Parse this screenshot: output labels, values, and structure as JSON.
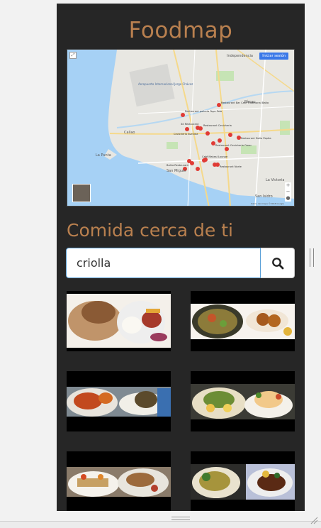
{
  "app": {
    "title": "Foodmap"
  },
  "map": {
    "button_label": "Iniciar sesión",
    "labels": {
      "independencia": "Independencia",
      "callao": "Callao",
      "rimac": "Rímac",
      "surquillo": "San Miguel",
      "la_victoria": "La Victoria",
      "san_isidro": "San Isidro",
      "la_punta": "La Punta",
      "aeropuerto": "Aeropuerto Internacional Jorge Chávez"
    },
    "markers": [
      {
        "label": "Restaurant pollería Tayo Polo"
      },
      {
        "label": "Restaurant Bar Café Tradicional Balta"
      },
      {
        "label": "3d Restaurant"
      },
      {
        "label": "Cevichería Avenida"
      },
      {
        "label": "Restaurant Cevichería"
      },
      {
        "label": "Restaurant Doña Pepita"
      },
      {
        "label": "Restaurant Cevichería Omar"
      },
      {
        "label": "Café Makasi Lounge"
      },
      {
        "label": "Restaurant Norte"
      },
      {
        "label": "Bahía Restaurant"
      }
    ],
    "copyright": "Datos del mapa ©2018 Google"
  },
  "section": {
    "title": "Comida cerca de ti"
  },
  "search": {
    "value": "criolla",
    "placeholder": "",
    "button_icon": "search-icon"
  },
  "food_cards": [
    {
      "name": "food-card-1"
    },
    {
      "name": "food-card-2"
    },
    {
      "name": "food-card-3"
    },
    {
      "name": "food-card-4"
    },
    {
      "name": "food-card-5"
    },
    {
      "name": "food-card-6"
    }
  ],
  "colors": {
    "accent": "#b9804f",
    "background": "#262626",
    "sea": "#a6d1f5"
  }
}
